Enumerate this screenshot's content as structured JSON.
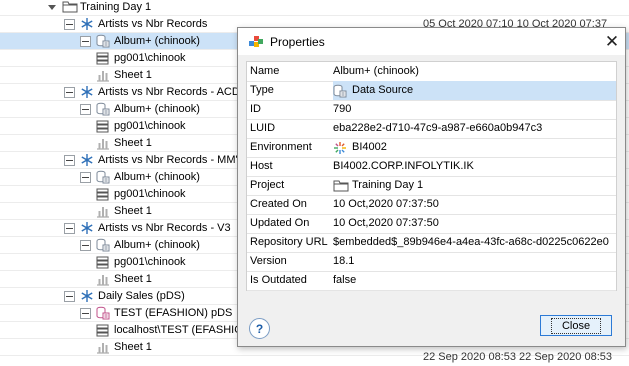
{
  "tree": {
    "rows": [
      {
        "label": "Training Day 1",
        "icon": "folder-icon",
        "stamp": "",
        "selected": false
      },
      {
        "label": "Artists vs Nbr Records",
        "icon": "snowflake-icon",
        "stamp": "05 Oct 2020 07:10 10 Oct 2020 07:37",
        "selected": false
      },
      {
        "label": "Album+ (chinook)",
        "icon": "datasource-icon",
        "stamp": "",
        "selected": true
      },
      {
        "label": "pg001\\chinook",
        "icon": "server-icon",
        "stamp": "",
        "selected": false
      },
      {
        "label": "Sheet 1",
        "icon": "sheet-icon",
        "stamp": "",
        "selected": false
      },
      {
        "label": "Artists vs Nbr Records - ACDC",
        "icon": "snowflake-icon",
        "stamp": "",
        "selected": false
      },
      {
        "label": "Album+ (chinook)",
        "icon": "datasource-icon",
        "stamp": "",
        "selected": false
      },
      {
        "label": "pg001\\chinook",
        "icon": "server-icon",
        "stamp": "",
        "selected": false
      },
      {
        "label": "Sheet 1",
        "icon": "sheet-icon",
        "stamp": "",
        "selected": false
      },
      {
        "label": "Artists vs Nbr Records - MM's",
        "icon": "snowflake-icon",
        "stamp": "",
        "selected": false
      },
      {
        "label": "Album+ (chinook)",
        "icon": "datasource-icon",
        "stamp": "",
        "selected": false
      },
      {
        "label": "pg001\\chinook",
        "icon": "server-icon",
        "stamp": "",
        "selected": false
      },
      {
        "label": "Sheet 1",
        "icon": "sheet-icon",
        "stamp": "",
        "selected": false
      },
      {
        "label": "Artists vs Nbr Records - V3",
        "icon": "snowflake-icon",
        "stamp": "",
        "selected": false
      },
      {
        "label": "Album+ (chinook)",
        "icon": "datasource-icon",
        "stamp": "",
        "selected": false
      },
      {
        "label": "pg001\\chinook",
        "icon": "server-icon",
        "stamp": "",
        "selected": false
      },
      {
        "label": "Sheet 1",
        "icon": "sheet-icon",
        "stamp": "",
        "selected": false
      },
      {
        "label": "Daily Sales (pDS)",
        "icon": "snowflake-icon",
        "stamp": "",
        "selected": false
      },
      {
        "label": "TEST (EFASHION) pDS",
        "icon": "datasource-pink-icon",
        "stamp": "",
        "selected": false
      },
      {
        "label": "localhost\\TEST (EFASHION)",
        "icon": "server-icon",
        "stamp": "",
        "selected": false
      },
      {
        "label": "Sheet 1",
        "icon": "sheet-icon",
        "stamp": "22 Sep 2020 08:53 22 Sep 2020 08:53",
        "selected": false
      }
    ]
  },
  "dialog": {
    "title": "Properties",
    "properties": [
      {
        "key": "Name",
        "value": "Album+ (chinook)",
        "icon": ""
      },
      {
        "key": "Type",
        "value": "Data Source",
        "icon": "datasource-icon"
      },
      {
        "key": "ID",
        "value": "790",
        "icon": ""
      },
      {
        "key": "LUID",
        "value": "eba228e2-d710-47c9-a987-e660a0b947c3",
        "icon": ""
      },
      {
        "key": "Environment",
        "value": "BI4002",
        "icon": "environment-icon"
      },
      {
        "key": "Host",
        "value": "BI4002.CORP.INFOLYTIK.IK",
        "icon": ""
      },
      {
        "key": "Project",
        "value": "Training Day 1",
        "icon": "folder-icon"
      },
      {
        "key": "Created On",
        "value": "10 Oct,2020  07:37:50",
        "icon": ""
      },
      {
        "key": "Updated On",
        "value": "10 Oct,2020  07:37:50",
        "icon": ""
      },
      {
        "key": "Repository URL",
        "value": "$embedded$_89b946e4-a4ea-43fc-a68c-d0225c0622e0",
        "icon": ""
      },
      {
        "key": "Version",
        "value": "18.1",
        "icon": ""
      },
      {
        "key": "Is Outdated",
        "value": "false",
        "icon": ""
      }
    ],
    "help_label": "?",
    "close_label": "Close",
    "close_glyph": "✕"
  },
  "colors": {
    "selection": "#cce2f7",
    "accent": "#2c7ad6",
    "datasource": "#5b7fb0",
    "datasource_pink": "#c0508a"
  }
}
